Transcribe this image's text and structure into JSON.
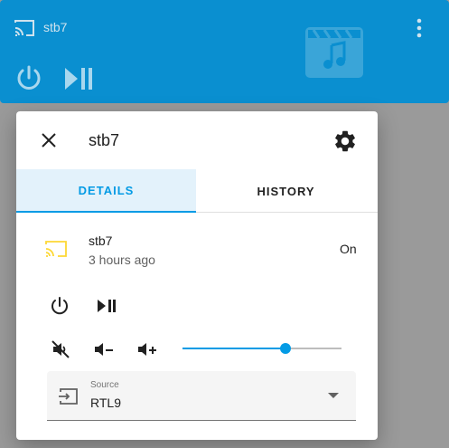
{
  "media_card": {
    "name": "stb7"
  },
  "dialog": {
    "title": "stb7",
    "tabs": [
      {
        "label": "DETAILS",
        "active": true
      },
      {
        "label": "HISTORY",
        "active": false
      }
    ],
    "entity": {
      "name": "stb7",
      "last_changed": "3 hours ago",
      "state": "On"
    },
    "volume": {
      "level": 0.65
    },
    "source": {
      "label": "Source",
      "value": "RTL9"
    }
  },
  "colors": {
    "accent": "#039be5",
    "card": "#0a8fd0",
    "cast_icon": "#fdd835"
  }
}
